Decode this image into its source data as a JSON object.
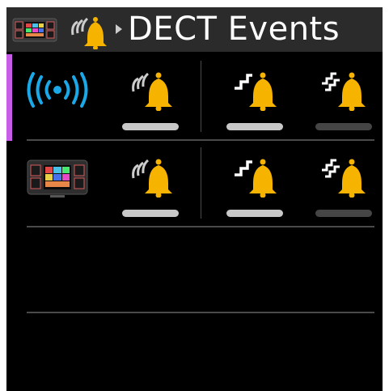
{
  "header": {
    "title": "DECT Events",
    "app_icon": "contacts-keypad-icon",
    "section_icon": "ringing-bell-icon",
    "breadcrumb_icon": "chevron-right-icon"
  },
  "colors": {
    "focus": "#c85ee8",
    "bell": "#f6b400",
    "signal": "#1aa8e8",
    "level_on": "#c8c8c8",
    "level_off": "#454545"
  },
  "rows": [
    {
      "icon": "dect-signal-icon",
      "focused": true,
      "events": [
        {
          "icon": "bell-ring-icon",
          "level": 1
        },
        {
          "icon": "bell-step-icon",
          "level": 1
        },
        {
          "icon": "bell-double-step-icon",
          "level": 0
        }
      ]
    },
    {
      "icon": "contacts-keypad-icon",
      "focused": false,
      "events": [
        {
          "icon": "bell-ring-icon",
          "level": 1
        },
        {
          "icon": "bell-step-icon",
          "level": 1
        },
        {
          "icon": "bell-double-step-icon",
          "level": 0
        }
      ]
    }
  ]
}
